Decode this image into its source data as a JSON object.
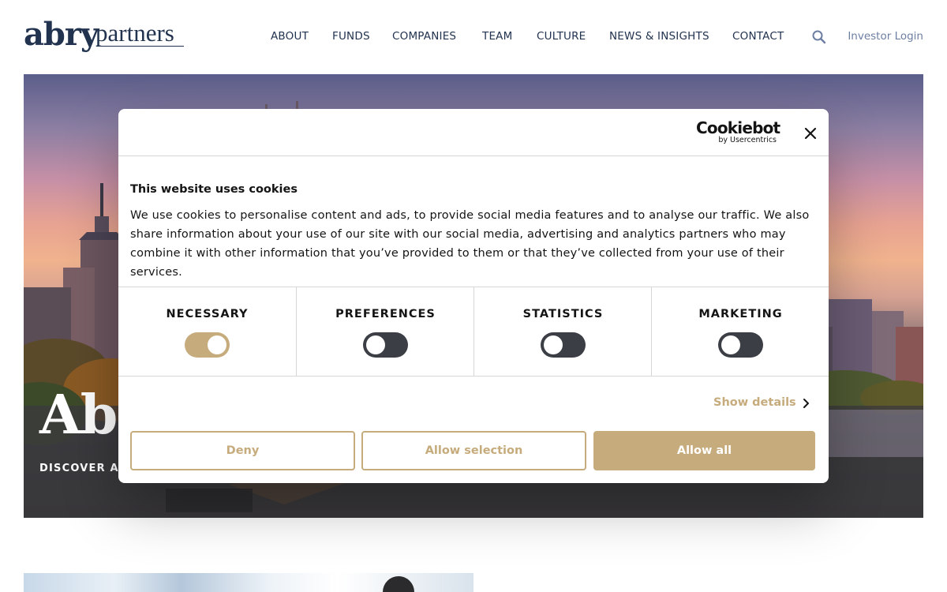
{
  "header": {
    "logo": {
      "brand": "abry",
      "suffix": "partners"
    },
    "nav": [
      {
        "label": "ABOUT"
      },
      {
        "label": "FUNDS"
      },
      {
        "label": "COMPANIES"
      },
      {
        "label": "TEAM"
      },
      {
        "label": "CULTURE"
      },
      {
        "label": "NEWS & INSIGHTS"
      },
      {
        "label": "CONTACT"
      }
    ],
    "search_icon": "search-icon",
    "investor_login": "Investor Login"
  },
  "hero": {
    "title": "Ab",
    "subtitle": "DISCOVER AB"
  },
  "cookie_dialog": {
    "brand": "Cookiebot",
    "brand_sub": "by Usercentrics",
    "close_icon": "close-icon",
    "title": "This website uses cookies",
    "body": "We use cookies to personalise content and ads, to provide social media features and to analyse our traffic. We also share information about your use of our site with our social media, advertising and analytics partners who may combine it with other information that you’ve provided to them or that they’ve collected from your use of their services.",
    "categories": [
      {
        "label": "NECESSARY",
        "enabled": true
      },
      {
        "label": "PREFERENCES",
        "enabled": false
      },
      {
        "label": "STATISTICS",
        "enabled": false
      },
      {
        "label": "MARKETING",
        "enabled": false
      }
    ],
    "show_details": "Show details",
    "chevron_icon": "chevron-right-icon",
    "buttons": {
      "deny": "Deny",
      "allow_selection": "Allow selection",
      "allow_all": "Allow all"
    }
  },
  "colors": {
    "navy": "#22334f",
    "accent": "#c6ab7c",
    "toggle_off": "#3b3e45",
    "link_muted": "#6d7ea3"
  }
}
